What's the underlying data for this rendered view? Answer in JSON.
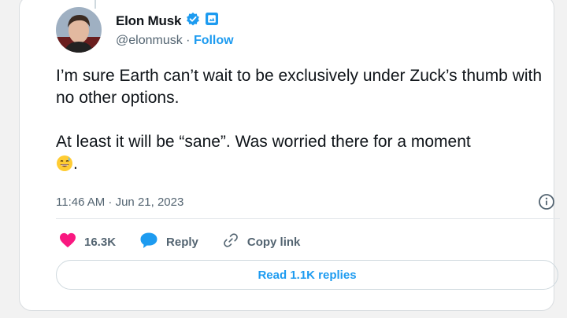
{
  "tweet": {
    "author_name": "Elon Musk",
    "handle": "@elonmusk",
    "separator": " · ",
    "follow_label": "Follow",
    "paragraph_1": "I’m sure Earth can’t wait to be exclusively under Zuck’s thumb with no other options.",
    "paragraph_2": "At least it will be “sane”. Was worried there for a moment",
    "paragraph_2_end": ".",
    "timestamp": "11:46 AM · Jun 21, 2023",
    "emoji_icon": "grinning-sweat-emoji"
  },
  "actions": {
    "likes_count": "16.3K",
    "reply_label": "Reply",
    "copy_link_label": "Copy link",
    "read_replies_label": "Read 1.1K replies"
  },
  "colors": {
    "accent": "#1d9bf0",
    "like": "#f91880",
    "verified_business": "#1d9bf0",
    "muted_text": "#536471"
  }
}
